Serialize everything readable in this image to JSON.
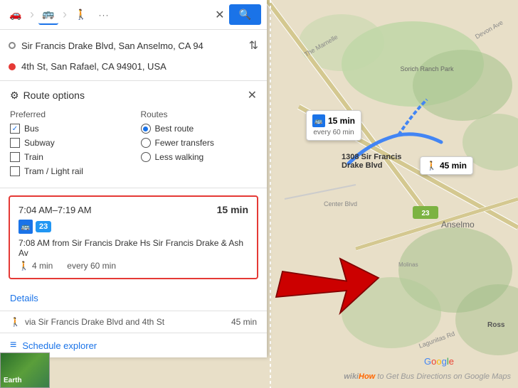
{
  "transport_modes": {
    "car": "🚗",
    "transit": "🚌",
    "train": "🚆",
    "walk": "🚶",
    "more": "···"
  },
  "search_btn_icon": "🔍",
  "close_icon": "✕",
  "origin": "Sir Francis Drake Blvd, San Anselmo, CA 94",
  "destination": "4th St, San Rafael, CA 94901, USA",
  "route_options": {
    "title": "Route options",
    "preferred_header": "Preferred",
    "routes_header": "Routes",
    "preferred": [
      {
        "label": "Bus",
        "checked": true
      },
      {
        "label": "Subway",
        "checked": false
      },
      {
        "label": "Train",
        "checked": false
      },
      {
        "label": "Tram / Light rail",
        "checked": false
      }
    ],
    "routes": [
      {
        "label": "Best route",
        "selected": true
      },
      {
        "label": "Fewer transfers",
        "selected": false
      },
      {
        "label": "Less walking",
        "selected": false
      }
    ]
  },
  "route_card": {
    "time_range": "7:04 AM–7:19 AM",
    "duration": "15 min",
    "route_number": "23",
    "detail": "7:08 AM from Sir Francis Drake Hs Sir Francis Drake & Ash Av",
    "walk_time": "4 min",
    "frequency": "every 60 min"
  },
  "details_link": "Details",
  "walking_route": {
    "prefix": "via Sir Francis Drake Blvd and 4th St",
    "duration": "45 min"
  },
  "schedule_label": "Schedule explorer",
  "earth_label": "Earth",
  "map_bus_info": {
    "time": "15 min",
    "sub": "every 60 min"
  },
  "map_walk_info": {
    "time": "45 min"
  },
  "map_street_label": "1308 Sir Francis\nDrake Blvd",
  "google_label": "Google",
  "wikihow_label": "wikiHow to Get Bus Directions on Google Maps"
}
